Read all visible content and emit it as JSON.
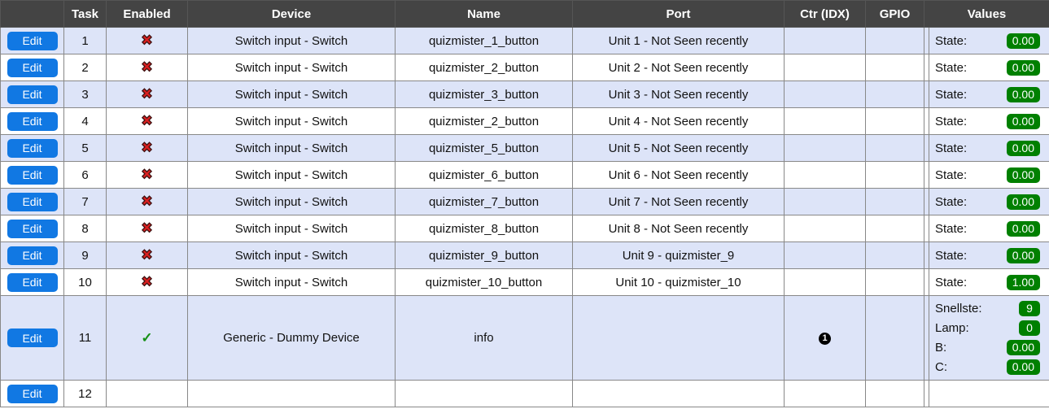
{
  "table": {
    "name": "devices-task-list",
    "columns": [
      {
        "key": "edit",
        "label": ""
      },
      {
        "key": "task",
        "label": "Task"
      },
      {
        "key": "enabled",
        "label": "Enabled"
      },
      {
        "key": "device",
        "label": "Device"
      },
      {
        "key": "name",
        "label": "Name"
      },
      {
        "key": "port",
        "label": "Port"
      },
      {
        "key": "ctr",
        "label": "Ctr (IDX)"
      },
      {
        "key": "gpio",
        "label": "GPIO"
      },
      {
        "key": "values",
        "label": "Values"
      }
    ],
    "edit_label": "Edit",
    "icons": {
      "disabled": "✖",
      "enabled": "✓",
      "ctr_idx_1": "1"
    },
    "rows": [
      {
        "task": "1",
        "enabled": "disabled",
        "device": "Switch input - Switch",
        "name": "quizmister_1_button",
        "port": "Unit 1 - Not Seen recently",
        "ctr": "",
        "gpio": "",
        "values": [
          {
            "label": "State:",
            "value": "0.00"
          }
        ]
      },
      {
        "task": "2",
        "enabled": "disabled",
        "device": "Switch input - Switch",
        "name": "quizmister_2_button",
        "port": "Unit 2 - Not Seen recently",
        "ctr": "",
        "gpio": "",
        "values": [
          {
            "label": "State:",
            "value": "0.00"
          }
        ]
      },
      {
        "task": "3",
        "enabled": "disabled",
        "device": "Switch input - Switch",
        "name": "quizmister_3_button",
        "port": "Unit 3 - Not Seen recently",
        "ctr": "",
        "gpio": "",
        "values": [
          {
            "label": "State:",
            "value": "0.00"
          }
        ]
      },
      {
        "task": "4",
        "enabled": "disabled",
        "device": "Switch input - Switch",
        "name": "quizmister_2_button",
        "port": "Unit 4 - Not Seen recently",
        "ctr": "",
        "gpio": "",
        "values": [
          {
            "label": "State:",
            "value": "0.00"
          }
        ]
      },
      {
        "task": "5",
        "enabled": "disabled",
        "device": "Switch input - Switch",
        "name": "quizmister_5_button",
        "port": "Unit 5 - Not Seen recently",
        "ctr": "",
        "gpio": "",
        "values": [
          {
            "label": "State:",
            "value": "0.00"
          }
        ]
      },
      {
        "task": "6",
        "enabled": "disabled",
        "device": "Switch input - Switch",
        "name": "quizmister_6_button",
        "port": "Unit 6 - Not Seen recently",
        "ctr": "",
        "gpio": "",
        "values": [
          {
            "label": "State:",
            "value": "0.00"
          }
        ]
      },
      {
        "task": "7",
        "enabled": "disabled",
        "device": "Switch input - Switch",
        "name": "quizmister_7_button",
        "port": "Unit 7 - Not Seen recently",
        "ctr": "",
        "gpio": "",
        "values": [
          {
            "label": "State:",
            "value": "0.00"
          }
        ]
      },
      {
        "task": "8",
        "enabled": "disabled",
        "device": "Switch input - Switch",
        "name": "quizmister_8_button",
        "port": "Unit 8 - Not Seen recently",
        "ctr": "",
        "gpio": "",
        "values": [
          {
            "label": "State:",
            "value": "0.00"
          }
        ]
      },
      {
        "task": "9",
        "enabled": "disabled",
        "device": "Switch input - Switch",
        "name": "quizmister_9_button",
        "port": "Unit 9 - quizmister_9",
        "ctr": "",
        "gpio": "",
        "values": [
          {
            "label": "State:",
            "value": "0.00"
          }
        ]
      },
      {
        "task": "10",
        "enabled": "disabled",
        "device": "Switch input - Switch",
        "name": "quizmister_10_button",
        "port": "Unit 10 - quizmister_10",
        "ctr": "",
        "gpio": "",
        "values": [
          {
            "label": "State:",
            "value": "1.00"
          }
        ]
      },
      {
        "task": "11",
        "enabled": "enabled",
        "device": "Generic - Dummy Device",
        "name": "info",
        "port": "",
        "ctr": "ctr_idx_1",
        "gpio": "",
        "values": [
          {
            "label": "Snellste:",
            "value": "9"
          },
          {
            "label": "Lamp:",
            "value": "0"
          },
          {
            "label": "B:",
            "value": "0.00"
          },
          {
            "label": "C:",
            "value": "0.00"
          }
        ]
      },
      {
        "task": "12",
        "enabled": "",
        "device": "",
        "name": "",
        "port": "",
        "ctr": "",
        "gpio": "",
        "values": []
      }
    ]
  },
  "colors": {
    "header_bg": "#444444",
    "row_alt_bg": "#dde4f8",
    "row_plain_bg": "#ffffff",
    "edit_button_bg": "#1178e3",
    "value_badge_bg": "#008000",
    "disabled_mark": "#d82020",
    "enabled_mark": "#169016",
    "border": "#888888"
  }
}
